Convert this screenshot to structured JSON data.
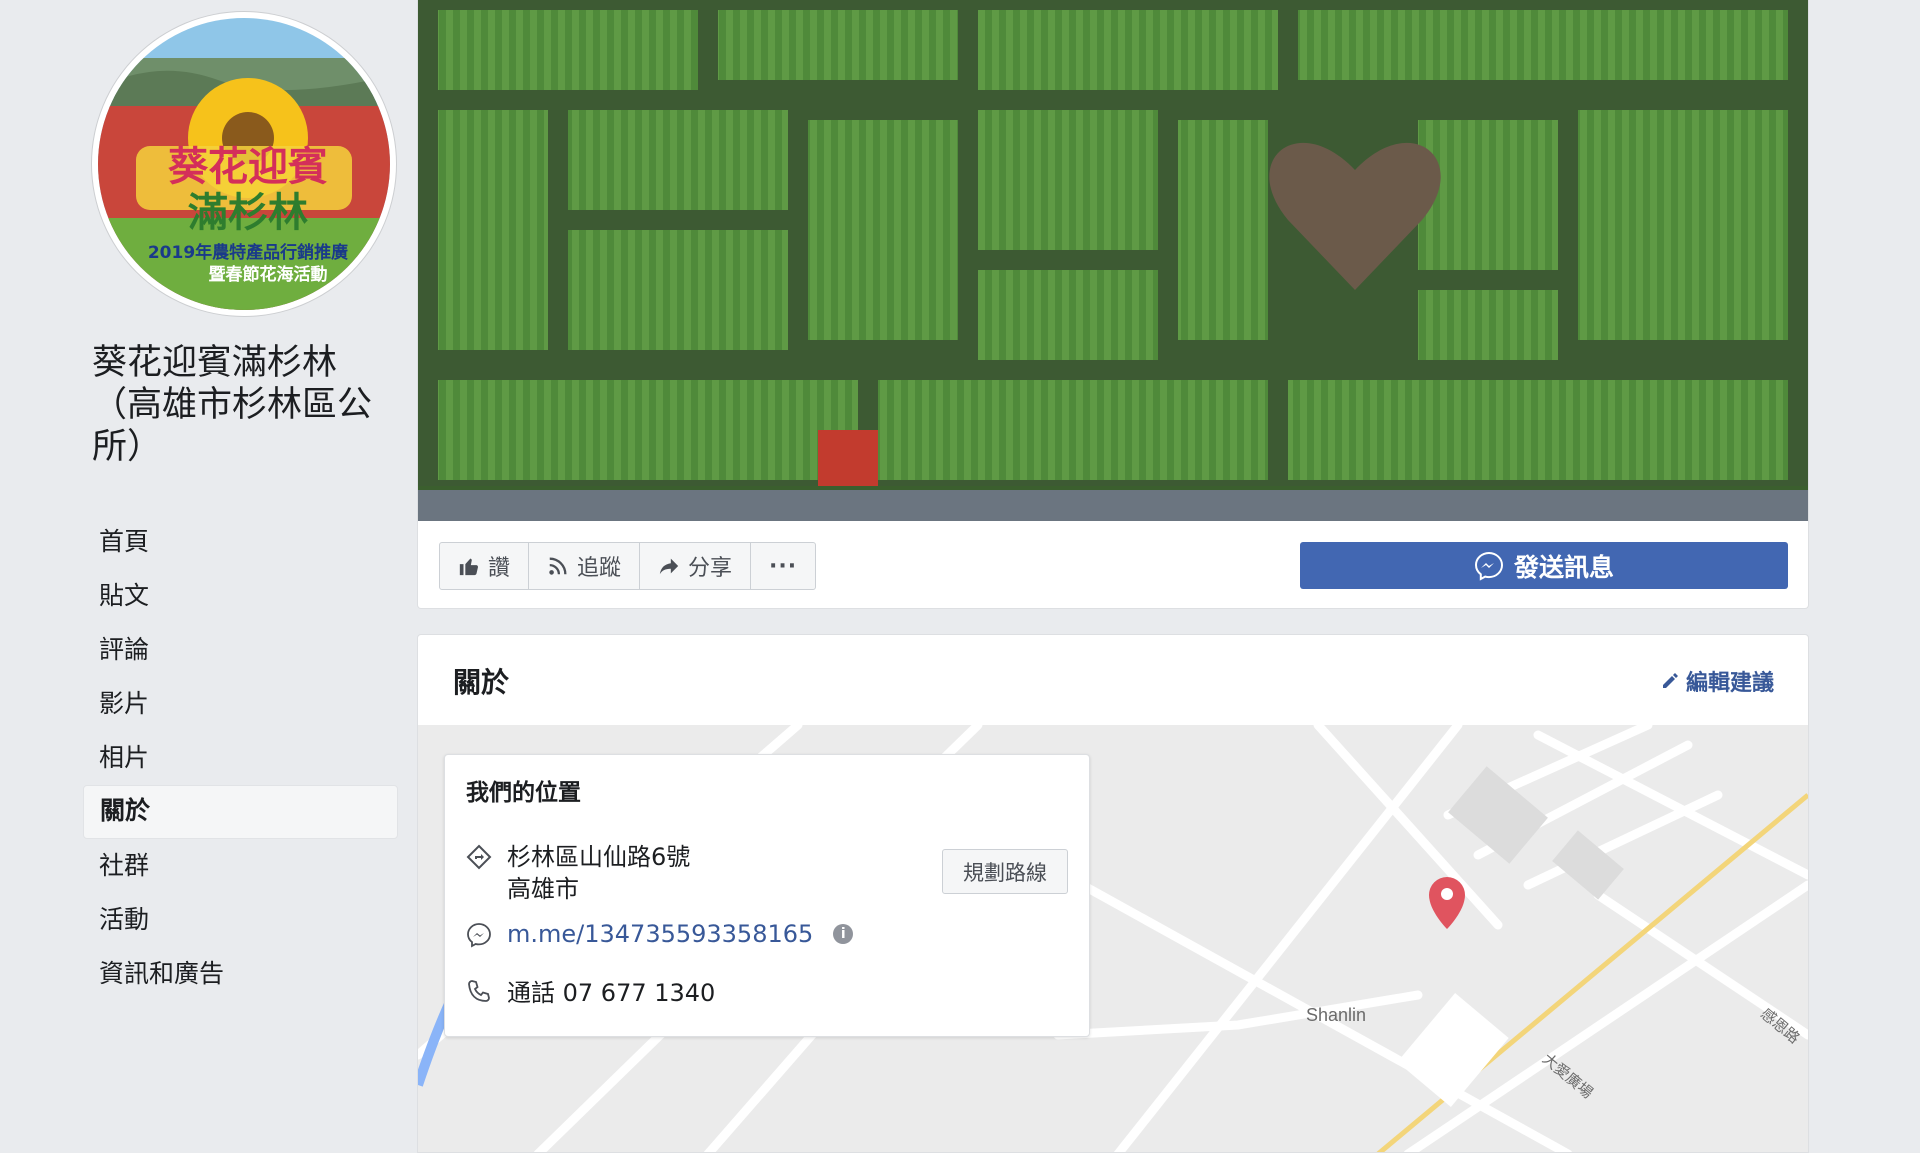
{
  "page": {
    "name_lines": [
      "葵花迎賓滿杉林",
      "（高雄市杉林區公",
      "所）"
    ]
  },
  "avatar": {
    "title_lines": [
      "葵花迎賓",
      "滿杉林"
    ],
    "caption_lines": [
      "2019年農特產品行銷推廣",
      "暨春節花海活動"
    ]
  },
  "nav": {
    "items": [
      {
        "label": "首頁",
        "active": false
      },
      {
        "label": "貼文",
        "active": false
      },
      {
        "label": "評論",
        "active": false
      },
      {
        "label": "影片",
        "active": false
      },
      {
        "label": "相片",
        "active": false
      },
      {
        "label": "關於",
        "active": true
      },
      {
        "label": "社群",
        "active": false
      },
      {
        "label": "活動",
        "active": false
      },
      {
        "label": "資訊和廣告",
        "active": false
      }
    ]
  },
  "actions": {
    "like": "讚",
    "follow": "追蹤",
    "share": "分享",
    "more": "···",
    "send_message": "發送訊息"
  },
  "about": {
    "title": "關於",
    "edit_suggestion": "編輯建議",
    "location": {
      "title": "我們的位置",
      "address_line1": "杉林區山仙路6號",
      "address_line2": "高雄市",
      "route_button": "規劃路線",
      "messenger_link": "m.me/134735593358165",
      "info_icon": "i",
      "phone": "通話 07 677 1340"
    },
    "map": {
      "town_label": "Shanlin",
      "road_label_1": "大愛廣場",
      "road_label_2": "感恩路"
    }
  },
  "colors": {
    "brand_blue": "#4267b2",
    "link_blue": "#385898",
    "pin_red": "#e0545f"
  }
}
